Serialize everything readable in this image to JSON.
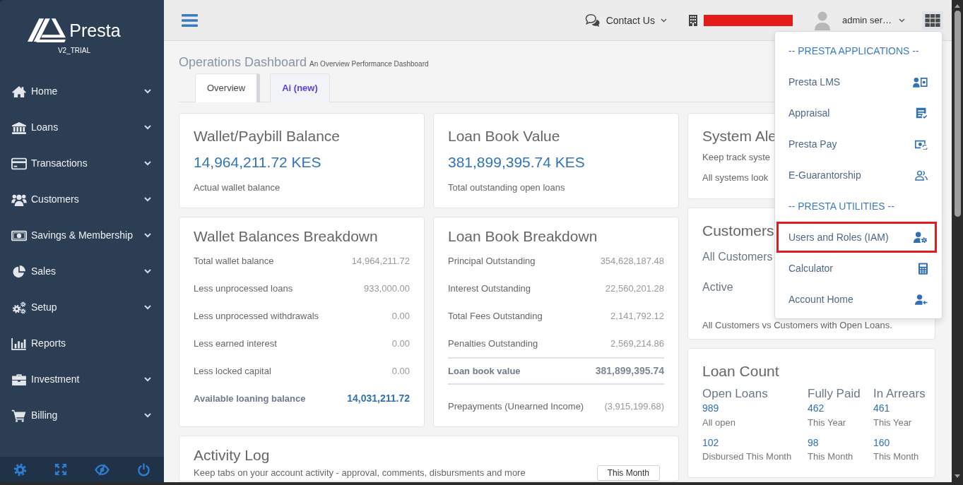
{
  "sidebar": {
    "brand": "Presta",
    "edition": "V2_TRIAL",
    "items": [
      {
        "label": "Home",
        "has_submenu": true
      },
      {
        "label": "Loans",
        "has_submenu": true
      },
      {
        "label": "Transactions",
        "has_submenu": true
      },
      {
        "label": "Customers",
        "has_submenu": true
      },
      {
        "label": "Savings & Membership",
        "has_submenu": true
      },
      {
        "label": "Sales",
        "has_submenu": true
      },
      {
        "label": "Setup",
        "has_submenu": true
      },
      {
        "label": "Reports",
        "has_submenu": false
      },
      {
        "label": "Investment",
        "has_submenu": true
      },
      {
        "label": "Billing",
        "has_submenu": true
      }
    ]
  },
  "header": {
    "contact": "Contact Us",
    "user": "admin ser…"
  },
  "page": {
    "title": "Operations Dashboard",
    "subtitle": "An Overview Performance Dashboard",
    "tabs": [
      {
        "label": "Overview",
        "selected": true,
        "emphasized": false
      },
      {
        "label": "Ai (new)",
        "selected": false,
        "emphasized": true
      }
    ]
  },
  "wallet_balance": {
    "title": "Wallet/Paybill Balance",
    "amount": "14,964,211.72 KES",
    "caption": "Actual wallet balance"
  },
  "loan_book_value": {
    "title": "Loan Book Value",
    "amount": "381,899,395.74 KES",
    "caption": "Total outstanding open loans"
  },
  "system_alerts": {
    "title": "System Ale",
    "description": "Keep track syste",
    "status": "All systems look"
  },
  "wallet_breakdown": {
    "title": "Wallet Balances Breakdown",
    "rows": [
      {
        "kind": "item",
        "label": "Total wallet balance",
        "value": "14,964,211.72"
      },
      {
        "kind": "item",
        "label": "Less unprocessed loans",
        "value": "933,000.00"
      },
      {
        "kind": "item",
        "label": "Less unprocessed withdrawals",
        "value": "0.00"
      },
      {
        "kind": "item",
        "label": "Less earned interest",
        "value": "0.00"
      },
      {
        "kind": "item",
        "label": "Less locked capital",
        "value": "0.00"
      },
      {
        "kind": "total",
        "label": "Available loaning balance",
        "value": "14,031,211.72"
      }
    ]
  },
  "loan_book_breakdown": {
    "title": "Loan Book Breakdown",
    "rows": [
      {
        "kind": "item",
        "label": "Principal Outstanding",
        "value": "354,628,187.48"
      },
      {
        "kind": "item",
        "label": "Interest Outstanding",
        "value": "22,560,201.28"
      },
      {
        "kind": "item",
        "label": "Total Fees Outstanding",
        "value": "2,141,792.12"
      },
      {
        "kind": "item",
        "label": "Penalties Outstanding",
        "value": "2,569,214.86"
      },
      {
        "kind": "ruled_total",
        "label": "Loan book value",
        "value": "381,899,395.74"
      },
      {
        "kind": "item",
        "label": "Prepayments (Unearned Income)",
        "value": "(3,915,199.68)"
      }
    ]
  },
  "customers": {
    "title": "Customers",
    "rows": [
      "All Customers",
      "Active"
    ],
    "footnote": "All Customers vs Customers with Open Loans."
  },
  "loan_count": {
    "title": "Loan Count",
    "columns": [
      {
        "heading": "Open Loans",
        "entries": [
          {
            "value": "989",
            "caption": "All open"
          },
          {
            "value": "102",
            "caption": "Disbursed This Month"
          }
        ]
      },
      {
        "heading": "Fully Paid",
        "entries": [
          {
            "value": "462",
            "caption": "This Year"
          },
          {
            "value": "98",
            "caption": "This Month"
          }
        ]
      },
      {
        "heading": "In Arrears",
        "entries": [
          {
            "value": "461",
            "caption": "This Year"
          },
          {
            "value": "160",
            "caption": "This Month"
          }
        ]
      }
    ]
  },
  "activity_log": {
    "title": "Activity Log",
    "description": "Keep tabs on your account activity - approval, comments, disbursments and more",
    "period_button": "This Month"
  },
  "app_menu": {
    "sections": [
      {
        "heading": "-- PRESTA APPLICATIONS --",
        "items": [
          {
            "label": "Presta LMS",
            "highlighted": false
          },
          {
            "label": "Appraisal",
            "highlighted": false
          },
          {
            "label": "Presta Pay",
            "highlighted": false
          },
          {
            "label": "E-Guarantorship",
            "highlighted": false
          }
        ]
      },
      {
        "heading": "-- PRESTA UTILITIES --",
        "items": [
          {
            "label": "Users and Roles (IAM)",
            "highlighted": true
          },
          {
            "label": "Calculator",
            "highlighted": false
          },
          {
            "label": "Account Home",
            "highlighted": false
          }
        ]
      }
    ]
  }
}
